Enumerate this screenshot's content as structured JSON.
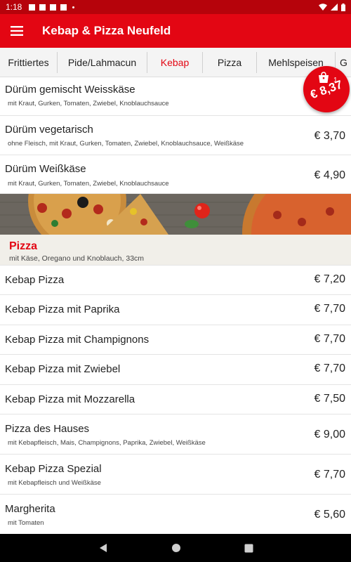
{
  "status": {
    "time": "1:18"
  },
  "appbar": {
    "title": "Kebap & Pizza Neufeld"
  },
  "tabs": [
    {
      "label": "Frittiertes"
    },
    {
      "label": "Pide/Lahmacun"
    },
    {
      "label": "Kebap",
      "active": true
    },
    {
      "label": "Pizza"
    },
    {
      "label": "Mehlspeisen"
    },
    {
      "label": "G"
    }
  ],
  "cart": {
    "count": "1",
    "total": "€ 8,37"
  },
  "kebap_items": [
    {
      "name": "Dürüm gemischt Weisskäse",
      "desc": "mit Kraut, Gurken, Tomaten, Zwiebel, Knoblauchsauce",
      "price": ""
    },
    {
      "name": "Dürüm vegetarisch",
      "desc": "ohne Fleisch, mit Kraut, Gurken, Tomaten, Zwiebel, Knoblauchsauce, Weißkäse",
      "price": "€ 3,70"
    },
    {
      "name": "Dürüm Weißkäse",
      "desc": "mit Kraut, Gurken, Tomaten, Zwiebel, Knoblauchsauce",
      "price": "€ 4,90"
    }
  ],
  "pizza_section": {
    "title": "Pizza",
    "desc": "mit Käse, Oregano und Knoblauch, 33cm"
  },
  "pizza_items": [
    {
      "name": "Kebap Pizza",
      "desc": "",
      "price": "€ 7,20"
    },
    {
      "name": "Kebap Pizza mit Paprika",
      "desc": "",
      "price": "€ 7,70"
    },
    {
      "name": "Kebap Pizza mit Champignons",
      "desc": "",
      "price": "€ 7,70"
    },
    {
      "name": "Kebap Pizza mit Zwiebel",
      "desc": "",
      "price": "€ 7,70"
    },
    {
      "name": "Kebap Pizza mit Mozzarella",
      "desc": "",
      "price": "€ 7,50"
    },
    {
      "name": "Pizza des Hauses",
      "desc": "mit Kebapfleisch, Mais, Champignons, Paprika, Zwiebel, Weißkäse",
      "price": "€ 9,00"
    },
    {
      "name": "Kebap Pizza Spezial",
      "desc": "mit Kebapfleisch und Weißkäse",
      "price": "€ 7,70"
    },
    {
      "name": "Margherita",
      "desc": "mit Tomaten",
      "price": "€ 5,60"
    }
  ],
  "colors": {
    "primary": "#e30613",
    "status_bar": "#b6030b",
    "section_bg": "#f1efe9"
  }
}
